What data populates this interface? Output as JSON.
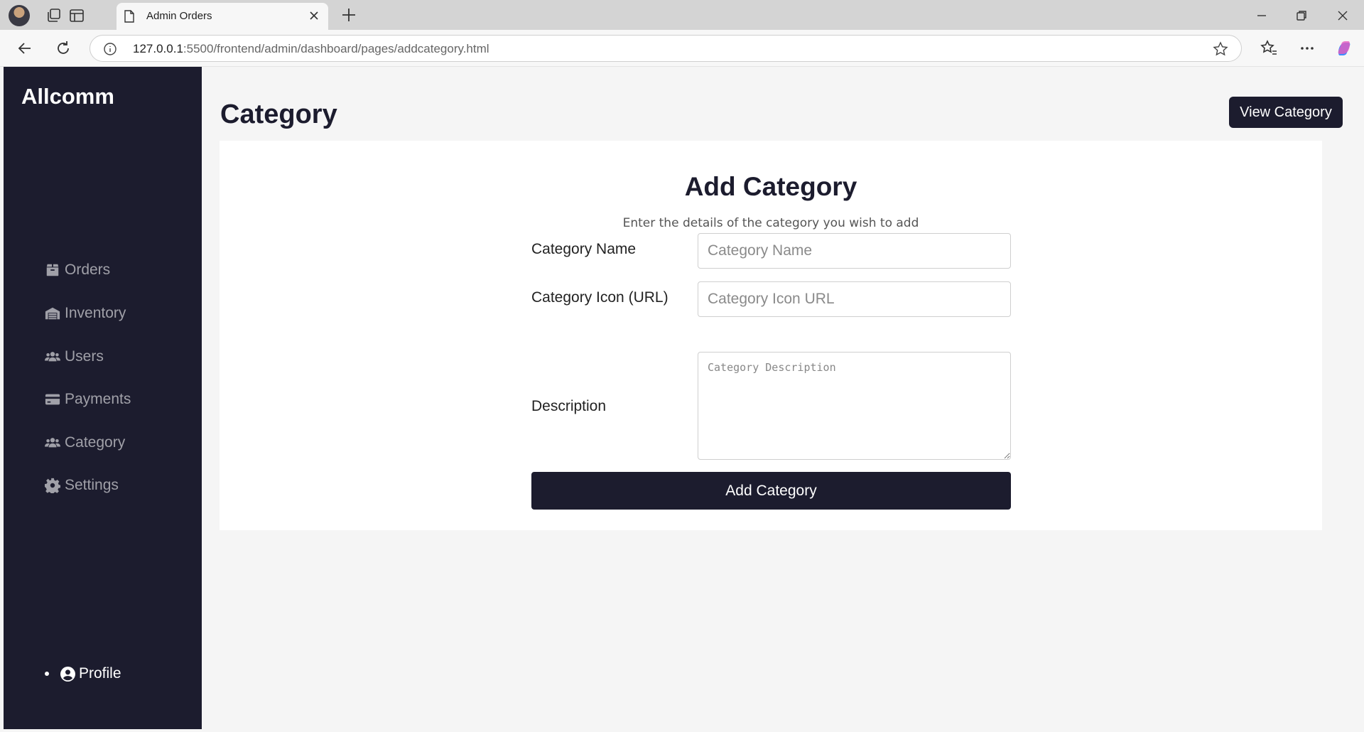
{
  "browser": {
    "tab_title": "Admin Orders",
    "url_host": "127.0.0.1",
    "url_rest": ":5500/frontend/admin/dashboard/pages/addcategory.html"
  },
  "sidebar": {
    "brand": "Allcomm",
    "items": [
      {
        "label": "Orders",
        "icon": "box-icon"
      },
      {
        "label": "Inventory",
        "icon": "warehouse-icon"
      },
      {
        "label": "Users",
        "icon": "users-icon"
      },
      {
        "label": "Payments",
        "icon": "credit-card-icon"
      },
      {
        "label": "Category",
        "icon": "users-icon"
      },
      {
        "label": "Settings",
        "icon": "gear-icon"
      }
    ],
    "profile_label": "Profile"
  },
  "header": {
    "title": "Category",
    "view_button": "View Category"
  },
  "form": {
    "title": "Add Category",
    "subtitle": "Enter the details of the category you wish to add",
    "name_label": "Category Name",
    "name_placeholder": "Category Name",
    "icon_label": "Category Icon (URL)",
    "icon_placeholder": "Category Icon URL",
    "description_label": "Description",
    "description_placeholder": "Category Description",
    "submit_label": "Add Category"
  },
  "colors": {
    "sidebar_bg": "#1c1c2e",
    "accent": "#1c1c2e",
    "nav_text": "#a0a0a8"
  }
}
